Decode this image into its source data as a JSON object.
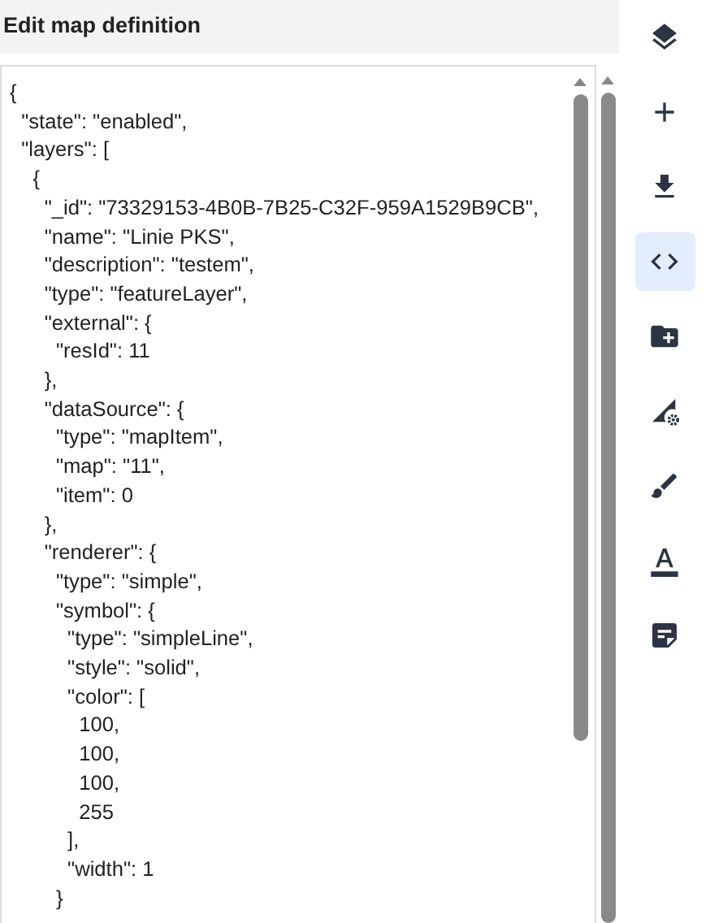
{
  "panel": {
    "title": "Edit map definition"
  },
  "editor": {
    "lines": [
      "{",
      "  \"state\": \"enabled\",",
      "  \"layers\": [",
      "    {",
      "      \"_id\": \"73329153-4B0B-7B25-C32F-959A1529B9CB\",",
      "      \"name\": \"Linie PKS\",",
      "      \"description\": \"testem\",",
      "      \"type\": \"featureLayer\",",
      "      \"external\": {",
      "        \"resId\": 11",
      "      },",
      "      \"dataSource\": {",
      "        \"type\": \"mapItem\",",
      "        \"map\": \"11\",",
      "        \"item\": 0",
      "      },",
      "      \"renderer\": {",
      "        \"type\": \"simple\",",
      "        \"symbol\": {",
      "          \"type\": \"simpleLine\",",
      "          \"style\": \"solid\",",
      "          \"color\": [",
      "            100,",
      "            100,",
      "            100,",
      "            255",
      "          ],",
      "          \"width\": 1",
      "        }"
    ]
  },
  "toolbar": [
    {
      "kind": "layers",
      "selected": false
    },
    {
      "kind": "add",
      "selected": false
    },
    {
      "kind": "download",
      "selected": false
    },
    {
      "kind": "code",
      "selected": true
    },
    {
      "kind": "folder-add",
      "selected": false
    },
    {
      "kind": "shape-settings",
      "selected": false
    },
    {
      "kind": "brush",
      "selected": false
    },
    {
      "kind": "text",
      "selected": false
    },
    {
      "kind": "note",
      "selected": false
    }
  ]
}
